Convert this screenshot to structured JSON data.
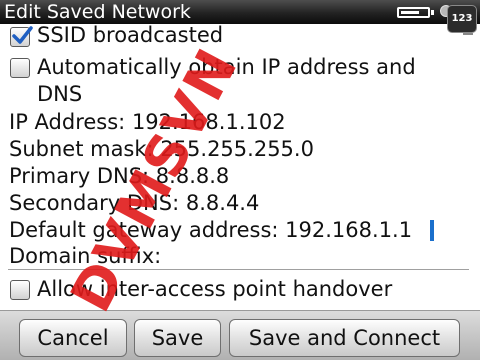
{
  "title_bar": {
    "title": "Edit Saved Network",
    "battery_level": 0.7,
    "keyboard_indicator": "123"
  },
  "settings": {
    "ssid_broadcasted": {
      "label": "SSID broadcasted",
      "checked": true
    },
    "auto_ip": {
      "label_line1": "Automatically obtain IP address and",
      "label_line2": "DNS",
      "checked": false
    },
    "ip_address": {
      "label": "IP Address:",
      "value": "192.168.1.102"
    },
    "subnet_mask": {
      "label": "Subnet mask:",
      "value": "255.255.255.0"
    },
    "primary_dns": {
      "label": "Primary DNS:",
      "value": "8.8.8.8"
    },
    "secondary_dns": {
      "label": "Secondary DNS:",
      "value": "8.8.4.4"
    },
    "default_gateway": {
      "label": "Default gateway address:",
      "value": "192.168.1.1"
    },
    "domain_suffix": {
      "label": "Domain suffix:",
      "value": ""
    },
    "inter_access_handover": {
      "label": "Allow inter-access point handover",
      "checked": false
    }
  },
  "buttons": {
    "cancel": "Cancel",
    "save": "Save",
    "save_and_connect": "Save and Connect"
  },
  "watermark": "DVMSVN"
}
